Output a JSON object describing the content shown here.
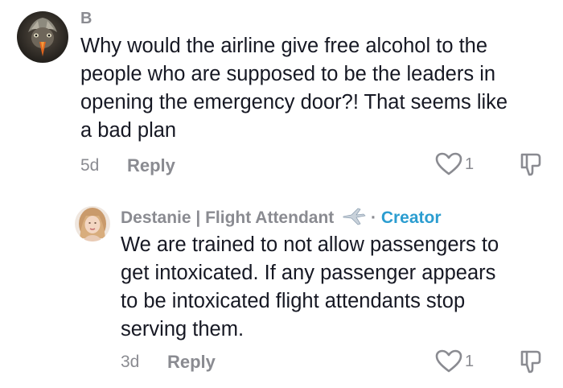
{
  "comments": [
    {
      "username": "B",
      "avatar_icon": "bird-avatar-icon",
      "lines": [
        "Why would the airline give free alcohol to the",
        "people who are supposed to be the leaders in",
        "opening the emergency door?! That seems like",
        "a bad plan"
      ],
      "date": "5d",
      "reply_label": "Reply",
      "like_count": "1"
    }
  ],
  "replies": [
    {
      "username": "Destanie | Flight Attendant",
      "username_emoji": "airplane-icon",
      "separator": "·",
      "creator_label": "Creator",
      "avatar_icon": "user-avatar-icon",
      "lines": [
        "We are trained to not allow passengers to",
        "get intoxicated. If any passenger appears",
        "to be intoxicated flight attendants stop",
        "serving them."
      ],
      "date": "3d",
      "reply_label": "Reply",
      "like_count": "1"
    }
  ],
  "colors": {
    "text": "#161823",
    "muted": "#8a8b91",
    "creator": "#2b9dd0"
  }
}
